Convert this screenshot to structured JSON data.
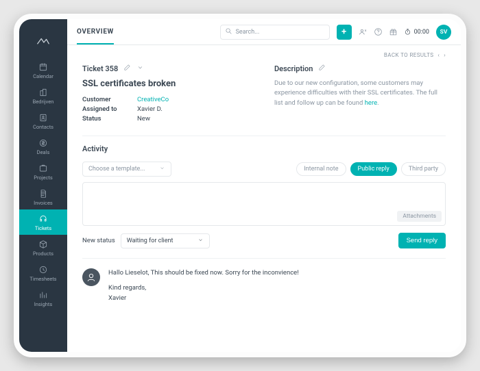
{
  "topbar": {
    "title": "OVERVIEW",
    "search_placeholder": "Search...",
    "timer": "00:00"
  },
  "avatar_initials": "SV",
  "sidebar": {
    "items": [
      {
        "label": "Calendar"
      },
      {
        "label": "Bedrijven"
      },
      {
        "label": "Contacts"
      },
      {
        "label": "Deals"
      },
      {
        "label": "Projects"
      },
      {
        "label": "Invoices"
      },
      {
        "label": "Tickets"
      },
      {
        "label": "Products"
      },
      {
        "label": "Timesheets"
      },
      {
        "label": "Insights"
      }
    ]
  },
  "back_label": "BACK TO RESULTS",
  "ticket": {
    "header_label": "Ticket 358",
    "title": "SSL certificates broken",
    "meta": {
      "customer_key": "Customer",
      "customer_value": "CreativeCo",
      "assigned_key": "Assigned to",
      "assigned_value": "Xavier D.",
      "status_key": "Status",
      "status_value": "New"
    }
  },
  "description": {
    "label": "Description",
    "body": "Due to our new configuration, some customers may experience difficulties with their SSL certificates. The full list and follow up can be found ",
    "link": "here"
  },
  "activity": {
    "label": "Activity",
    "template_placeholder": "Choose a template...",
    "tabs": {
      "internal": "Internal note",
      "public": "Public reply",
      "third": "Third party"
    },
    "attachments_label": "Attachments",
    "new_status_label": "New status",
    "new_status_value": "Waiting for client",
    "send_label": "Send reply"
  },
  "feed": {
    "body": "Hallo Lieselot, This should be fixed now. Sorry for the inconvience!",
    "sig1": "Kind regards,",
    "sig2": "Xavier"
  }
}
